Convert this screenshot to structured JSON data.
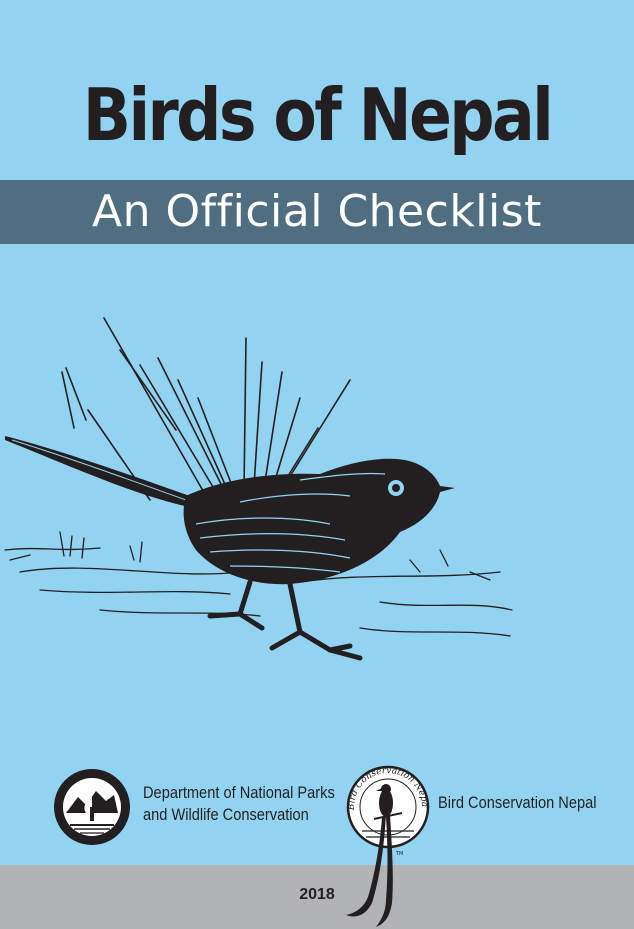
{
  "cover": {
    "title": "Birds of Nepal",
    "subtitle": "An Official Checklist",
    "year": "2018",
    "colors": {
      "background": "#93d3f2",
      "band": "#4f6e82",
      "footer": "#b1b3b6",
      "ink": "#231f20"
    }
  },
  "illustration": {
    "icon": "bird-sketch-icon"
  },
  "partners": {
    "dnpwc": {
      "logo": "dnpwc-seal-icon",
      "line1": "Department of National Parks",
      "line2": "and Wildlife Conservation"
    },
    "bcn": {
      "logo": "bcn-seal-icon",
      "name": "Bird Conservation Nepal",
      "seal_text": "Bird Conservation Nepal",
      "trademark": "TM"
    }
  }
}
